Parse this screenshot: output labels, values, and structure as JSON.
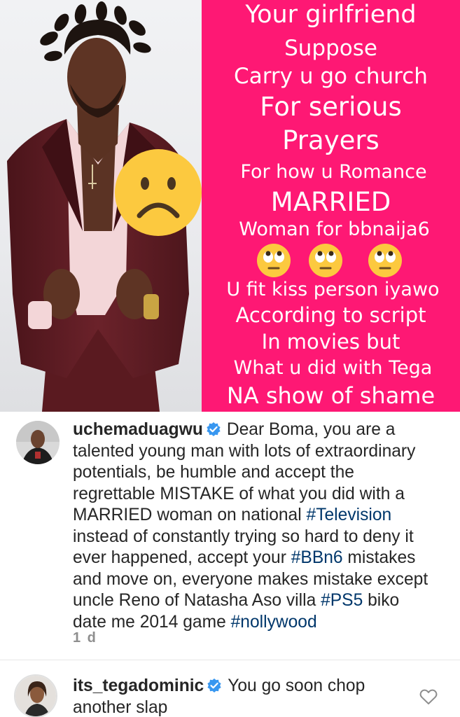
{
  "post": {
    "poster_text": {
      "line1": "Your girlfriend",
      "line2": "Suppose",
      "line3": "Carry u go church",
      "line4": "For serious",
      "line5": "Prayers",
      "line6": "For how u Romance",
      "line7": "MARRIED",
      "line8": "Woman for bbnaija6",
      "line9": "U fit kiss person iyawo",
      "line10": "According to script",
      "line11": "In movies but",
      "line12": "What u did with Tega",
      "line13": "NA show of shame"
    },
    "emojis": [
      "sad-face",
      "face-with-rolling-eyes",
      "face-with-rolling-eyes",
      "face-with-rolling-eyes"
    ],
    "colors": {
      "poster_background": "#fe1874",
      "poster_text": "#ffffff",
      "suit": "#5e1b22"
    }
  },
  "comments": [
    {
      "username": "uchemaduagwu",
      "verified": true,
      "text_parts": [
        "Dear Boma, you are a talented young man with lots of extraordinary potentials, be humble and accept the regrettable MISTAKE of what you did with a MARRIED woman on national ",
        "#Television",
        " instead of constantly trying so hard to deny it ever happened, accept your ",
        "#BBn6",
        " mistakes and move on, everyone makes mistake except uncle Reno of Natasha Aso villa ",
        "#PS5",
        " biko date me 2014 game ",
        "#nollywood"
      ],
      "time": "1 d"
    },
    {
      "username": "its_tegadominic",
      "verified": true,
      "text": "You go soon chop another slap"
    }
  ],
  "colors": {
    "hashtag": "#00376b",
    "verified_badge": "#3897f0",
    "meta_text": "#8e8e8e"
  }
}
